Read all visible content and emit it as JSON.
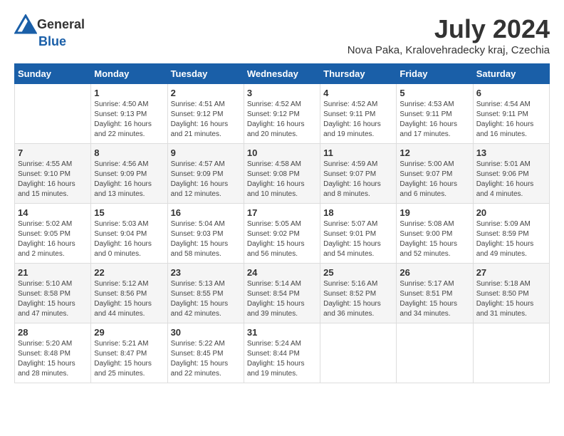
{
  "header": {
    "logo_general": "General",
    "logo_blue": "Blue",
    "month_title": "July 2024",
    "location": "Nova Paka, Kralovehradecky kraj, Czechia"
  },
  "days_of_week": [
    "Sunday",
    "Monday",
    "Tuesday",
    "Wednesday",
    "Thursday",
    "Friday",
    "Saturday"
  ],
  "weeks": [
    {
      "days": [
        {
          "date": "",
          "sunrise": "",
          "sunset": "",
          "daylight": ""
        },
        {
          "date": "1",
          "sunrise": "Sunrise: 4:50 AM",
          "sunset": "Sunset: 9:13 PM",
          "daylight": "Daylight: 16 hours and 22 minutes."
        },
        {
          "date": "2",
          "sunrise": "Sunrise: 4:51 AM",
          "sunset": "Sunset: 9:12 PM",
          "daylight": "Daylight: 16 hours and 21 minutes."
        },
        {
          "date": "3",
          "sunrise": "Sunrise: 4:52 AM",
          "sunset": "Sunset: 9:12 PM",
          "daylight": "Daylight: 16 hours and 20 minutes."
        },
        {
          "date": "4",
          "sunrise": "Sunrise: 4:52 AM",
          "sunset": "Sunset: 9:11 PM",
          "daylight": "Daylight: 16 hours and 19 minutes."
        },
        {
          "date": "5",
          "sunrise": "Sunrise: 4:53 AM",
          "sunset": "Sunset: 9:11 PM",
          "daylight": "Daylight: 16 hours and 17 minutes."
        },
        {
          "date": "6",
          "sunrise": "Sunrise: 4:54 AM",
          "sunset": "Sunset: 9:11 PM",
          "daylight": "Daylight: 16 hours and 16 minutes."
        }
      ]
    },
    {
      "days": [
        {
          "date": "7",
          "sunrise": "Sunrise: 4:55 AM",
          "sunset": "Sunset: 9:10 PM",
          "daylight": "Daylight: 16 hours and 15 minutes."
        },
        {
          "date": "8",
          "sunrise": "Sunrise: 4:56 AM",
          "sunset": "Sunset: 9:09 PM",
          "daylight": "Daylight: 16 hours and 13 minutes."
        },
        {
          "date": "9",
          "sunrise": "Sunrise: 4:57 AM",
          "sunset": "Sunset: 9:09 PM",
          "daylight": "Daylight: 16 hours and 12 minutes."
        },
        {
          "date": "10",
          "sunrise": "Sunrise: 4:58 AM",
          "sunset": "Sunset: 9:08 PM",
          "daylight": "Daylight: 16 hours and 10 minutes."
        },
        {
          "date": "11",
          "sunrise": "Sunrise: 4:59 AM",
          "sunset": "Sunset: 9:07 PM",
          "daylight": "Daylight: 16 hours and 8 minutes."
        },
        {
          "date": "12",
          "sunrise": "Sunrise: 5:00 AM",
          "sunset": "Sunset: 9:07 PM",
          "daylight": "Daylight: 16 hours and 6 minutes."
        },
        {
          "date": "13",
          "sunrise": "Sunrise: 5:01 AM",
          "sunset": "Sunset: 9:06 PM",
          "daylight": "Daylight: 16 hours and 4 minutes."
        }
      ]
    },
    {
      "days": [
        {
          "date": "14",
          "sunrise": "Sunrise: 5:02 AM",
          "sunset": "Sunset: 9:05 PM",
          "daylight": "Daylight: 16 hours and 2 minutes."
        },
        {
          "date": "15",
          "sunrise": "Sunrise: 5:03 AM",
          "sunset": "Sunset: 9:04 PM",
          "daylight": "Daylight: 16 hours and 0 minutes."
        },
        {
          "date": "16",
          "sunrise": "Sunrise: 5:04 AM",
          "sunset": "Sunset: 9:03 PM",
          "daylight": "Daylight: 15 hours and 58 minutes."
        },
        {
          "date": "17",
          "sunrise": "Sunrise: 5:05 AM",
          "sunset": "Sunset: 9:02 PM",
          "daylight": "Daylight: 15 hours and 56 minutes."
        },
        {
          "date": "18",
          "sunrise": "Sunrise: 5:07 AM",
          "sunset": "Sunset: 9:01 PM",
          "daylight": "Daylight: 15 hours and 54 minutes."
        },
        {
          "date": "19",
          "sunrise": "Sunrise: 5:08 AM",
          "sunset": "Sunset: 9:00 PM",
          "daylight": "Daylight: 15 hours and 52 minutes."
        },
        {
          "date": "20",
          "sunrise": "Sunrise: 5:09 AM",
          "sunset": "Sunset: 8:59 PM",
          "daylight": "Daylight: 15 hours and 49 minutes."
        }
      ]
    },
    {
      "days": [
        {
          "date": "21",
          "sunrise": "Sunrise: 5:10 AM",
          "sunset": "Sunset: 8:58 PM",
          "daylight": "Daylight: 15 hours and 47 minutes."
        },
        {
          "date": "22",
          "sunrise": "Sunrise: 5:12 AM",
          "sunset": "Sunset: 8:56 PM",
          "daylight": "Daylight: 15 hours and 44 minutes."
        },
        {
          "date": "23",
          "sunrise": "Sunrise: 5:13 AM",
          "sunset": "Sunset: 8:55 PM",
          "daylight": "Daylight: 15 hours and 42 minutes."
        },
        {
          "date": "24",
          "sunrise": "Sunrise: 5:14 AM",
          "sunset": "Sunset: 8:54 PM",
          "daylight": "Daylight: 15 hours and 39 minutes."
        },
        {
          "date": "25",
          "sunrise": "Sunrise: 5:16 AM",
          "sunset": "Sunset: 8:52 PM",
          "daylight": "Daylight: 15 hours and 36 minutes."
        },
        {
          "date": "26",
          "sunrise": "Sunrise: 5:17 AM",
          "sunset": "Sunset: 8:51 PM",
          "daylight": "Daylight: 15 hours and 34 minutes."
        },
        {
          "date": "27",
          "sunrise": "Sunrise: 5:18 AM",
          "sunset": "Sunset: 8:50 PM",
          "daylight": "Daylight: 15 hours and 31 minutes."
        }
      ]
    },
    {
      "days": [
        {
          "date": "28",
          "sunrise": "Sunrise: 5:20 AM",
          "sunset": "Sunset: 8:48 PM",
          "daylight": "Daylight: 15 hours and 28 minutes."
        },
        {
          "date": "29",
          "sunrise": "Sunrise: 5:21 AM",
          "sunset": "Sunset: 8:47 PM",
          "daylight": "Daylight: 15 hours and 25 minutes."
        },
        {
          "date": "30",
          "sunrise": "Sunrise: 5:22 AM",
          "sunset": "Sunset: 8:45 PM",
          "daylight": "Daylight: 15 hours and 22 minutes."
        },
        {
          "date": "31",
          "sunrise": "Sunrise: 5:24 AM",
          "sunset": "Sunset: 8:44 PM",
          "daylight": "Daylight: 15 hours and 19 minutes."
        },
        {
          "date": "",
          "sunrise": "",
          "sunset": "",
          "daylight": ""
        },
        {
          "date": "",
          "sunrise": "",
          "sunset": "",
          "daylight": ""
        },
        {
          "date": "",
          "sunrise": "",
          "sunset": "",
          "daylight": ""
        }
      ]
    }
  ]
}
